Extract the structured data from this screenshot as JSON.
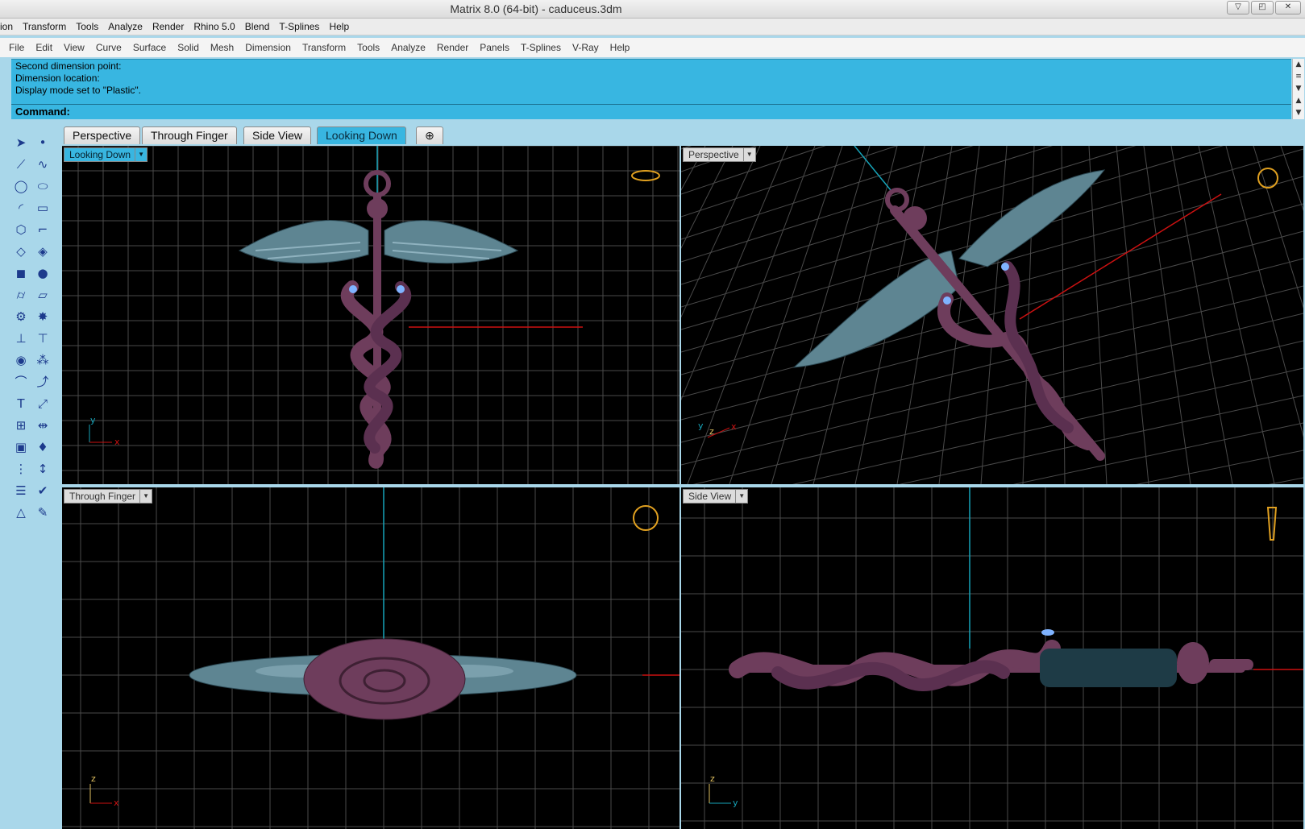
{
  "window": {
    "title": "Matrix 8.0 (64-bit) - caduceus.3dm"
  },
  "menu_top": [
    "ion",
    "Transform",
    "Tools",
    "Analyze",
    "Render",
    "Rhino 5.0",
    "Blend",
    "T-Splines",
    "Help"
  ],
  "menu_main": [
    "File",
    "Edit",
    "View",
    "Curve",
    "Surface",
    "Solid",
    "Mesh",
    "Dimension",
    "Transform",
    "Tools",
    "Analyze",
    "Render",
    "Panels",
    "T-Splines",
    "V-Ray",
    "Help"
  ],
  "command": {
    "history": [
      "Second dimension point:",
      "Dimension location:",
      "Display mode set to \"Plastic\"."
    ],
    "prompt": "Command:"
  },
  "tabs": [
    "Perspective",
    "Through Finger",
    "Side View",
    "Looking Down"
  ],
  "active_tab": "Looking Down",
  "viewports": {
    "top_left": {
      "label": "Looking Down",
      "axes": [
        "y",
        "x"
      ]
    },
    "top_right": {
      "label": "Perspective",
      "axes": [
        "y",
        "z",
        "x"
      ]
    },
    "bottom_left": {
      "label": "Through Finger",
      "axes": [
        "z",
        "x"
      ]
    },
    "bottom_right": {
      "label": "Side View",
      "axes": [
        "z",
        "y"
      ]
    }
  },
  "colors": {
    "command_bg": "#38b6e1",
    "viewport_bg": "#000000",
    "grid": "#555555",
    "snake": "#6e3d5c",
    "wing": "#5e8592",
    "axis_x": "#cc1111",
    "axis_y": "#16a3b8"
  },
  "toolbar_icons": [
    "select-arrow-icon",
    "point-icon",
    "polyline-icon",
    "curve-points-icon",
    "circle-icon",
    "ellipse-icon",
    "arc-icon",
    "rectangle-icon",
    "polygon-icon",
    "fillet-icon",
    "surface-icon",
    "edit-surface-icon",
    "box-icon",
    "sphere-icon",
    "cylinder-icon",
    "plane-icon",
    "gear-icon",
    "explode-icon",
    "dimension-icon",
    "align-icon",
    "boolean-icon",
    "group-icon",
    "pipe-icon",
    "curve-edit-icon",
    "text-icon",
    "scale-icon",
    "array-icon",
    "mirror-icon",
    "render-icon",
    "gems-icon",
    "grid-icon",
    "height-icon",
    "layers-icon",
    "check-icon",
    "shapes-icon",
    "paint-icon"
  ]
}
